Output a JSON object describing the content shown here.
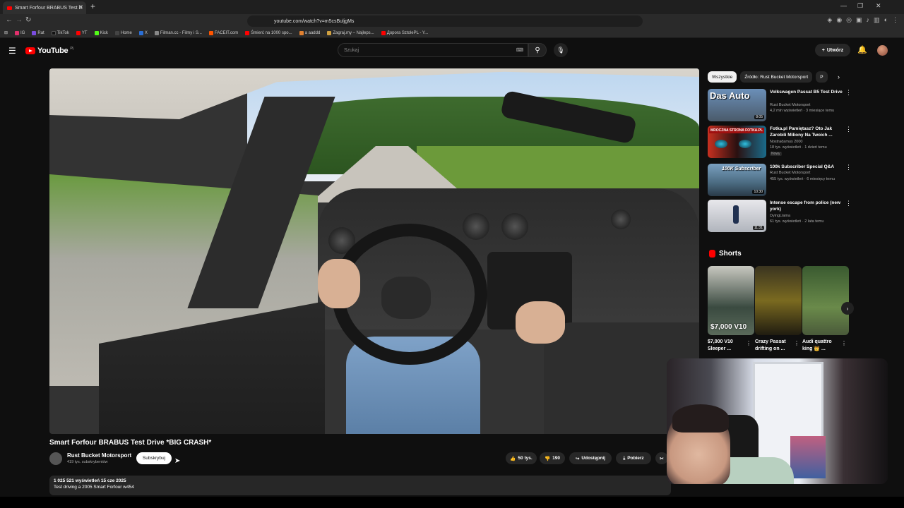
{
  "browser": {
    "tab_title": "Smart Forfour BRABUS Test D",
    "url": "youtube.com/watch?v=m5csBuljgMs",
    "bookmarks": [
      {
        "label": "IG",
        "color": "#e1306c"
      },
      {
        "label": "Rat",
        "color": "#7b4de0"
      },
      {
        "label": "TikTok",
        "color": "#111111"
      },
      {
        "label": "YT",
        "color": "#ff0000"
      },
      {
        "label": "Kick",
        "color": "#53fc18"
      },
      {
        "label": "Home",
        "color": "#444444"
      },
      {
        "label": "X",
        "color": "#2b6fd6"
      },
      {
        "label": "Filman.cc - Filmy i S...",
        "color": "#888888"
      },
      {
        "label": "FACEIT.com",
        "color": "#ff5500"
      },
      {
        "label": "Śmierć na 1000 spo...",
        "color": "#ff0000"
      },
      {
        "label": "a aaddd",
        "color": "#e08030"
      },
      {
        "label": "Zagraj.my – Najleps...",
        "color": "#d0a040"
      },
      {
        "label": "Дорога SztolePL - Y...",
        "color": "#ff0000"
      }
    ]
  },
  "header": {
    "logo_text": "YouTube",
    "country": "PL",
    "search_placeholder": "Szukaj",
    "create_label": "Utwórz"
  },
  "video": {
    "title": "Smart Forfour BRABUS Test Drive *BIG CRASH*",
    "channel": "Rust Bucket Motorsport",
    "subscribers": "419 tys. subskrybentów",
    "subscribe_label": "Subskrybuj",
    "likes": "50 tys.",
    "dislikes": "190",
    "share_label": "Udostępnij",
    "download_label": "Pobierz",
    "description_meta": "1 025 521 wyświetleń  15 cze 2025",
    "description_text": "Test driving a 2005 Smart Forfour w454"
  },
  "sidebar": {
    "chips": [
      {
        "label": "Wszystkie",
        "active": true
      },
      {
        "label": "Źródło: Rust Bucket Motorsport",
        "active": false
      },
      {
        "label": "P",
        "active": false
      }
    ],
    "recommendations": [
      {
        "title": "Volkswagen Passat B5 Test Drive",
        "channel": "Rust Bucket Motorsport",
        "meta": "4,2 mln wyświetleń · 3 miesiące temu",
        "duration": "8:05",
        "thumb_text": "Das Auto",
        "badge": ""
      },
      {
        "title": "Fotka.pl Pamiętasz? Oto Jak Zarobili Miliony Na Twoich ...",
        "channel": "Nostradamus 2000",
        "meta": "18 tys. wyświetleń · 1 dzień temu",
        "duration": "",
        "thumb_text": "MROCZNA STRONA FOTKA.PL",
        "badge": "Nowy"
      },
      {
        "title": "100k Subscriber Special Q&A",
        "channel": "Rust Bucket Motorsport",
        "meta": "455 tys. wyświetleń · 6 miesięcy temu",
        "duration": "10:30",
        "thumb_text": "100K Subscriber",
        "badge": ""
      },
      {
        "title": "Intense escape from police (new york)",
        "channel": "DyingLlama",
        "meta": "61 tys. wyświetleń · 2 lata temu",
        "duration": "11:31",
        "thumb_text": "",
        "badge": ""
      }
    ],
    "shorts_label": "Shorts",
    "shorts": [
      {
        "title": "$7,000 V10 Sleeper ...",
        "overlay": "$7,000 V10"
      },
      {
        "title": "Crazy Passat drifting on ...",
        "overlay": ""
      },
      {
        "title": "Audi quattro king 👑 ...",
        "overlay": ""
      }
    ]
  },
  "icons": {
    "menu": "hamburger-icon",
    "search": "search-icon",
    "mic": "microphone-icon",
    "bell": "bell-icon",
    "like": "thumbs-up-icon",
    "dislike": "thumbs-down-icon",
    "share": "share-icon",
    "download": "download-icon"
  },
  "colors": {
    "yt_red": "#ff0000",
    "background": "#0f0f0f",
    "pill": "#272727"
  }
}
